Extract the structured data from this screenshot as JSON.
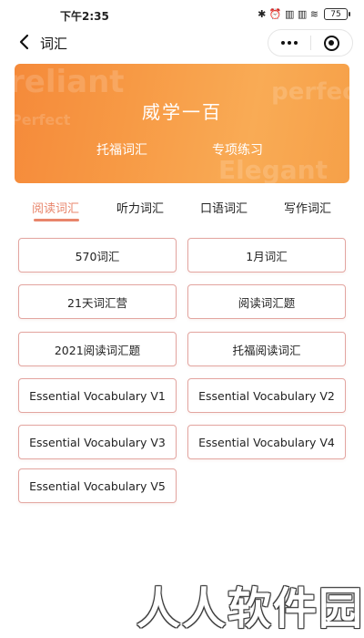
{
  "status_bar": {
    "time": "下午2:35",
    "indicators": "✱ ⏰ ▥ ▥ ≋",
    "battery": "75"
  },
  "nav": {
    "title": "词汇"
  },
  "banner": {
    "title": "威学一百",
    "link_toefl": "托福词汇",
    "link_practice": "专项练习",
    "bg_words": [
      "reliant",
      "perfect",
      "Perfect",
      "Elegant"
    ]
  },
  "tabs": [
    {
      "label": "阅读词汇",
      "active": true
    },
    {
      "label": "听力词汇",
      "active": false
    },
    {
      "label": "口语词汇",
      "active": false
    },
    {
      "label": "写作词汇",
      "active": false
    }
  ],
  "items": [
    "570词汇",
    "1月词汇",
    "21天词汇营",
    "阅读词汇题",
    "2021阅读词汇题",
    "托福阅读词汇",
    "Essential Vocabulary V1",
    "Essential Vocabulary V2",
    "Essential Vocabulary V3",
    "Essential Vocabulary V4",
    "Essential Vocabulary V5"
  ],
  "watermark": "人人软件园",
  "colors": {
    "accent": "#e8856b",
    "banner_start": "#f58a3a",
    "banner_end": "#f9ab55",
    "item_border": "#e3a5a0"
  }
}
